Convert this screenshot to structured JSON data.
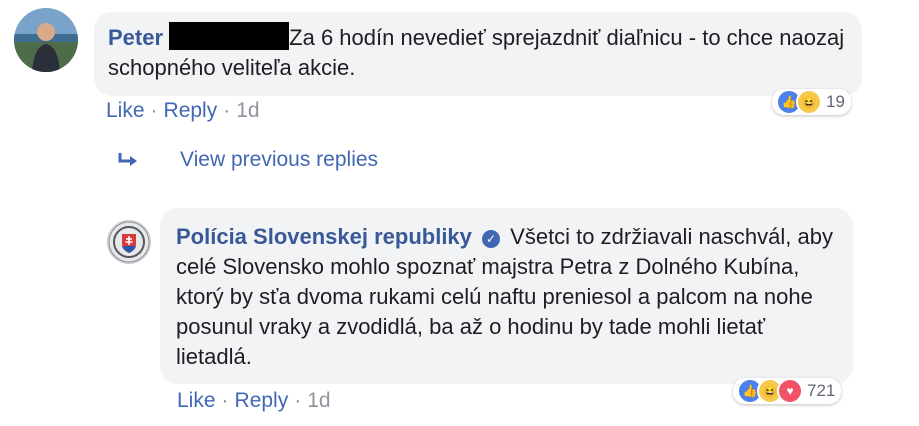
{
  "comment1": {
    "author": "Peter",
    "text": "Za 6 hodín nevedieť sprejazdniť diaľnicu - to chce naozaj schopného veliteľa akcie.",
    "actions": {
      "like": "Like",
      "reply": "Reply",
      "time": "1d",
      "dot": "·"
    },
    "reactions": {
      "count": "19",
      "icons": [
        "like-icon",
        "haha-icon"
      ]
    }
  },
  "view_previous": {
    "label": "View previous replies",
    "icon": "reply-arrow-icon"
  },
  "reply1": {
    "author": "Polícia Slovenskej republiky",
    "verified": true,
    "text": "Všetci to zdržiavali naschvál, aby celé Slovensko mohlo spoznať majstra Petra z Dolného Kubína, ktorý by sťa dvoma rukami celú naftu preniesol a palcom na nohe posunul vraky a zvodidlá, ba až o hodinu by tade mohli lietať lietadlá.",
    "actions": {
      "like": "Like",
      "reply": "Reply",
      "time": "1d",
      "dot": "·"
    },
    "reactions": {
      "count": "721",
      "icons": [
        "like-icon",
        "haha-icon",
        "love-icon"
      ]
    }
  },
  "colors": {
    "link": "#385898",
    "action": "#4267b2",
    "bubble": "#f2f3f5",
    "meta": "#90949c"
  }
}
